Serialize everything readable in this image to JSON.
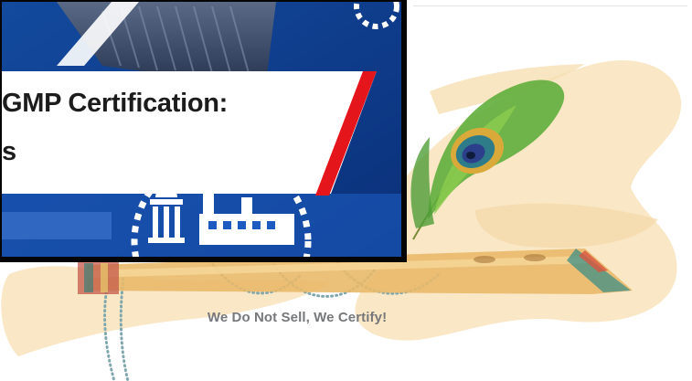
{
  "banner": {
    "title_line1": "GMP Certification:",
    "title_line2": "s"
  },
  "tagline": "We Do Not Sell, We Certify!",
  "colors": {
    "banner_blue": "#0d3d8f",
    "accent_red": "#e4161b",
    "tagline_gray": "#77787a",
    "paint_splash": "#f6ddb0"
  },
  "icons": [
    "peacock-feather-icon",
    "flute-icon",
    "temple-icon",
    "factory-icon"
  ]
}
